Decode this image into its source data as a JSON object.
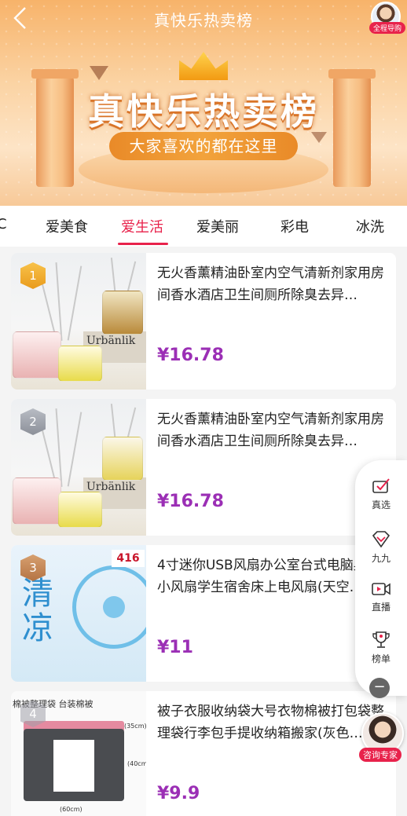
{
  "header": {
    "title": "真快乐热卖榜",
    "back_icon": "chevron-left-icon",
    "guide_label": "全程导购"
  },
  "banner": {
    "headline": "真快乐热卖榜",
    "subline": "大家喜欢的都在这里"
  },
  "tabs": [
    {
      "label": "C",
      "active": false
    },
    {
      "label": "爱美食",
      "active": false
    },
    {
      "label": "爱生活",
      "active": true
    },
    {
      "label": "爱美丽",
      "active": false
    },
    {
      "label": "彩电",
      "active": false
    },
    {
      "label": "冰洗",
      "active": false
    }
  ],
  "products": [
    {
      "rank": "1",
      "title": "无火香薰精油卧室内空气清新剂家用房间香水酒店卫生间厕所除臭去异…",
      "price": "¥16.78",
      "brand_text": "Urbänlik"
    },
    {
      "rank": "2",
      "title": "无火香薰精油卧室内空气清新剂家用房间香水酒店卫生间厕所除臭去异…",
      "price": "¥16.78",
      "brand_text": "Urbänlik"
    },
    {
      "rank": "3",
      "title": "4寸迷你USB风扇办公室台式电脑桌面小风扇学生宿舍床上电风扇(天空…",
      "price": "¥11",
      "image_text": "清凉",
      "image_logo": "416"
    },
    {
      "rank": "4",
      "title": "被子衣服收纳袋大号衣物棉被打包袋整理袋行李包手提收纳箱搬家(灰色…",
      "price": "¥9.9",
      "image_label": "棉被整理袋 台装棉被",
      "dims": [
        "(35cm)",
        "(40cm)",
        "(60cm)"
      ]
    }
  ],
  "sidebar": {
    "items": [
      {
        "label": "真选",
        "icon": "checkmark-envelope-icon"
      },
      {
        "label": "九九",
        "icon": "heart-chevron-icon"
      },
      {
        "label": "直播",
        "icon": "video-camera-icon"
      },
      {
        "label": "榜单",
        "icon": "trophy-icon"
      }
    ],
    "collapse_icon": "minus-icon",
    "consult_label": "咨询专家"
  },
  "colors": {
    "accent": "#e8224b",
    "price": "#9b2fb5",
    "banner_orange": "#f7b36a"
  }
}
